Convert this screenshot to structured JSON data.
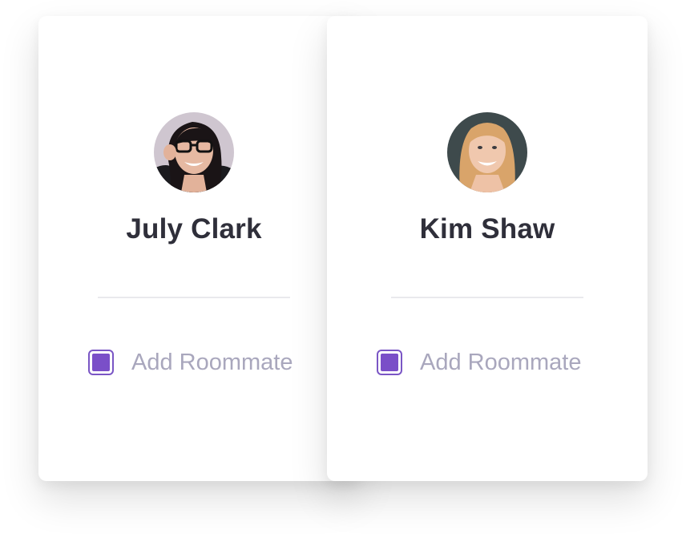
{
  "accent_color": "#7a4fc8",
  "cards": [
    {
      "name": "July Clark",
      "avatar_icon": "avatar-photo",
      "checkbox_label": "Add Roommate",
      "checked": true
    },
    {
      "name": "Kim Shaw",
      "avatar_icon": "avatar-photo",
      "checkbox_label": "Add Roommate",
      "checked": true
    }
  ]
}
